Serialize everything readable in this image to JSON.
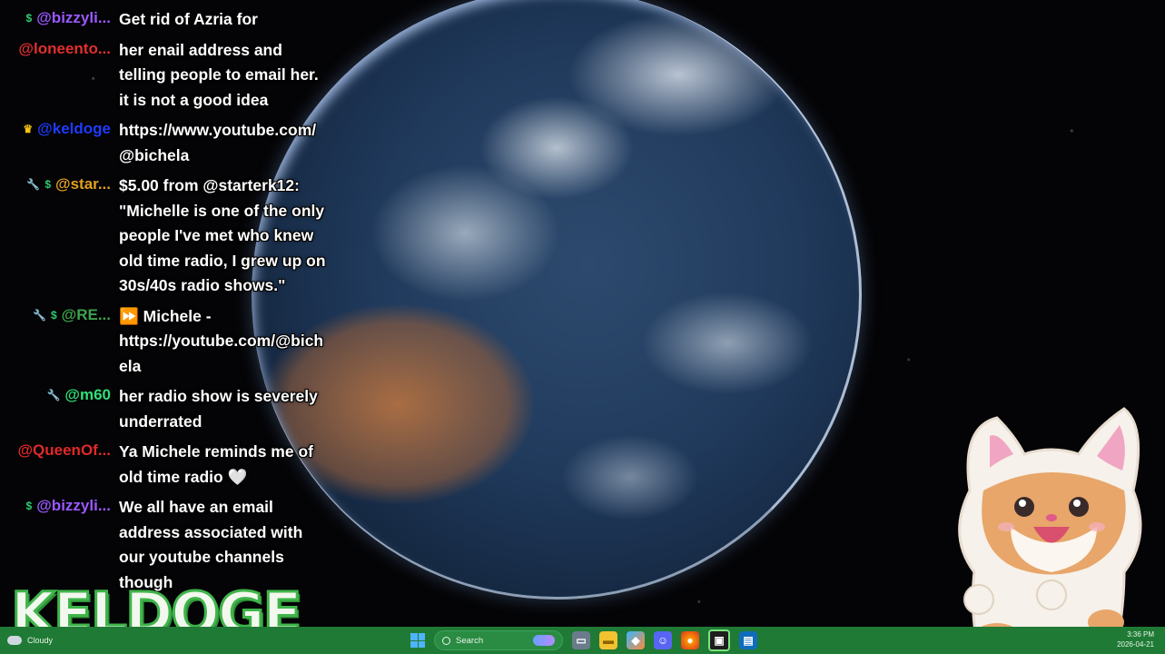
{
  "chat": [
    {
      "badges": [
        "money-icon"
      ],
      "user": "@bizzyli...",
      "color": "#9b59ff",
      "text": "Get rid of Azria for"
    },
    {
      "badges": [],
      "user": "@loneento...",
      "color": "#e03030",
      "text": "her enail address and telling people to email her. it is not a good idea"
    },
    {
      "badges": [
        "crown-icon"
      ],
      "user": "@keldoge",
      "color": "#1e3cff",
      "text": "https://www.youtube.com/@bichela"
    },
    {
      "badges": [
        "wrench-icon",
        "money-icon"
      ],
      "user": "@star...",
      "color": "#e0a020",
      "text": "$5.00 from @starterk12: \"Michelle is one of the only people I've met who knew old time radio, I grew up on 30s/40s radio shows.\""
    },
    {
      "badges": [
        "wrench-icon",
        "money-icon"
      ],
      "user": "@RE...",
      "color": "#3fa34d",
      "text": "⏩ Michele - https://youtube.com/@bichela"
    },
    {
      "badges": [
        "wrench-icon"
      ],
      "user": "@m60",
      "color": "#2ee07a",
      "text": "her radio show is severely underrated"
    },
    {
      "badges": [],
      "user": "@QueenOf...",
      "color": "#e02a2a",
      "text": "Ya Michele reminds me of old time radio 🤍"
    },
    {
      "badges": [
        "money-icon"
      ],
      "user": "@bizzyli...",
      "color": "#9b59ff",
      "text": "We all have an email address associated with our youtube channels though"
    }
  ],
  "watermark": "KELDOGE",
  "taskbar": {
    "weather": "Cloudy",
    "search_placeholder": "Search",
    "apps": [
      "file-explorer-icon",
      "folder-icon",
      "copilot-icon",
      "discord-icon",
      "firefox-icon",
      "terminal-icon",
      "outlook-icon"
    ],
    "time": "3:36 PM",
    "date": "2026-04-21"
  },
  "colors": {
    "taskbar": "#1f7a35",
    "brand_green": "#3fb54a"
  }
}
